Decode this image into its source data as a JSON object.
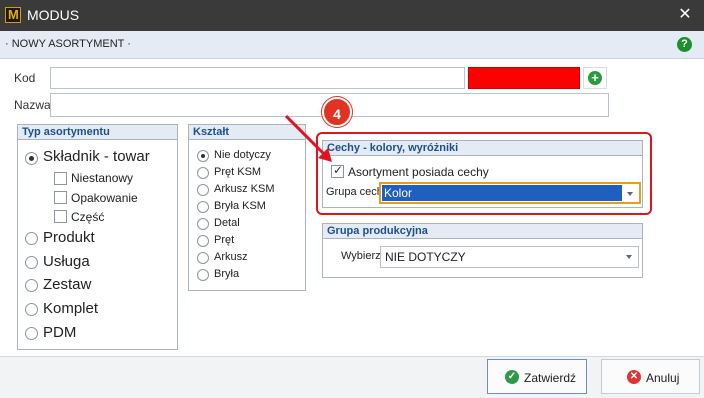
{
  "window": {
    "logo_letter": "M",
    "title": "MODUS",
    "close_glyph": "✕"
  },
  "header": {
    "title": "· NOWY ASORTYMENT ·",
    "help_glyph": "?"
  },
  "form": {
    "kod_label": "Kod",
    "kod_value": "",
    "nazwa_label": "Nazwa",
    "nazwa_value": "",
    "color_swatch": "#ff0000",
    "add_glyph": "+"
  },
  "typ_asortymentu": {
    "title": "Typ asortymentu",
    "options": [
      "Składnik - towar",
      "Produkt",
      "Usługa",
      "Zestaw",
      "Komplet",
      "PDM"
    ],
    "selected": "Składnik - towar",
    "sub_options": [
      "Niestanowy",
      "Opakowanie",
      "Część"
    ]
  },
  "ksztalt": {
    "title": "Kształt",
    "options": [
      "Nie dotyczy",
      "Pręt KSM",
      "Arkusz KSM",
      "Bryła KSM",
      "Detal",
      "Pręt",
      "Arkusz",
      "Bryła"
    ],
    "selected": "Nie dotyczy"
  },
  "cechy": {
    "title": "Cechy - kolory, wyróżniki",
    "checkbox_label": "Asortyment posiada cechy",
    "checkbox_checked": true,
    "grupa_label": "Grupa cech",
    "grupa_value": "Kolor"
  },
  "annotation": {
    "badge": "4",
    "color": "#e0141f"
  },
  "grupa_produkcyjna": {
    "title": "Grupa produkcyjna",
    "wybierz_label": "Wybierz",
    "wybierz_value": "NIE DOTYCZY"
  },
  "footer": {
    "ok_label": "Zatwierdź",
    "cancel_label": "Anuluj",
    "ok_icon": "✓",
    "cancel_icon": "✕"
  }
}
